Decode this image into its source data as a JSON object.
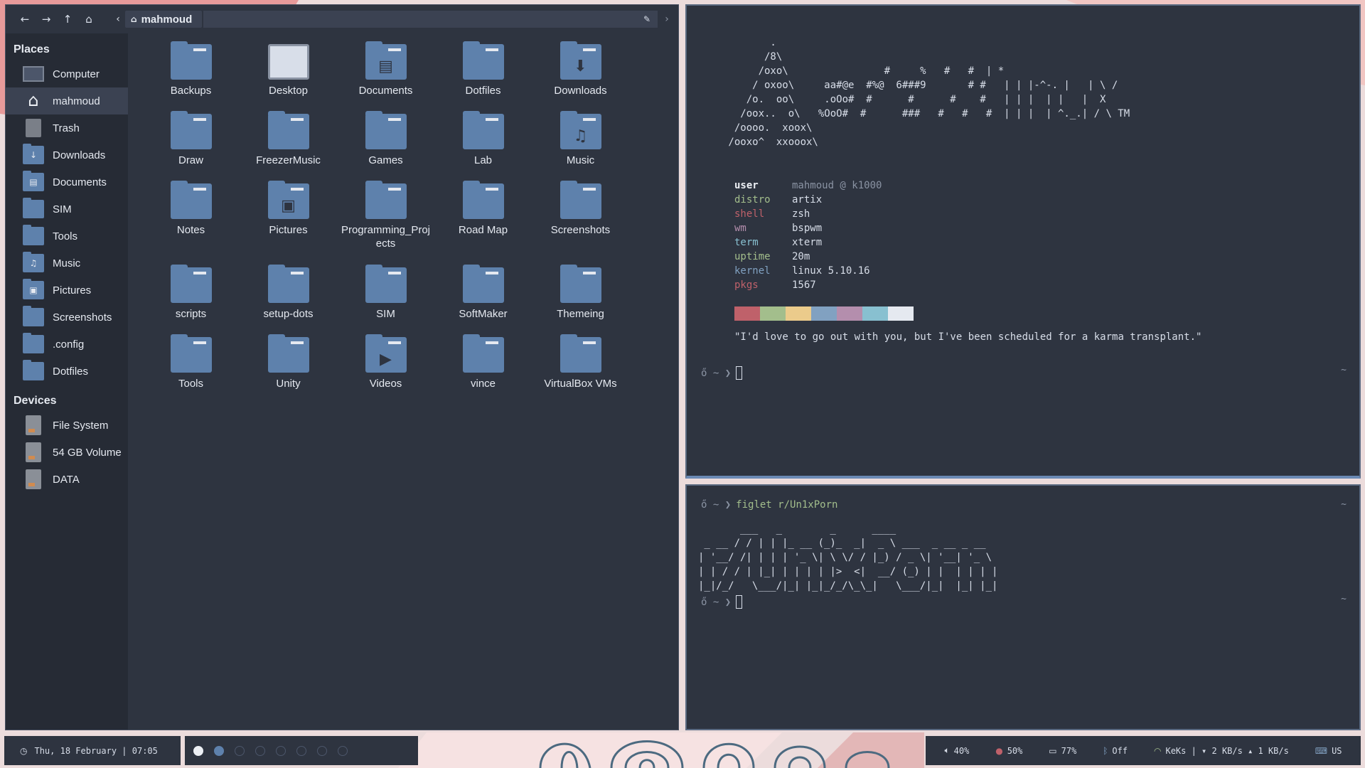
{
  "filemanager": {
    "path": "mahmoud",
    "places_header": "Places",
    "devices_header": "Devices",
    "places": [
      {
        "label": "Computer",
        "icon": "computer-icon"
      },
      {
        "label": "mahmoud",
        "icon": "home-icon"
      },
      {
        "label": "Trash",
        "icon": "trash-icon"
      },
      {
        "label": "Downloads",
        "icon": "downloads-folder-icon"
      },
      {
        "label": "Documents",
        "icon": "documents-folder-icon"
      },
      {
        "label": "SIM",
        "icon": "folder-icon"
      },
      {
        "label": "Tools",
        "icon": "folder-icon"
      },
      {
        "label": "Music",
        "icon": "music-folder-icon"
      },
      {
        "label": "Pictures",
        "icon": "pictures-folder-icon"
      },
      {
        "label": "Screenshots",
        "icon": "folder-icon"
      },
      {
        "label": ".config",
        "icon": "folder-icon"
      },
      {
        "label": "Dotfiles",
        "icon": "folder-icon"
      }
    ],
    "devices": [
      {
        "label": "File System",
        "icon": "drive-icon"
      },
      {
        "label": "54 GB Volume",
        "icon": "drive-icon"
      },
      {
        "label": "DATA",
        "icon": "drive-icon"
      }
    ],
    "items": [
      {
        "label": "Backups",
        "icon": "folder-icon"
      },
      {
        "label": "Desktop",
        "icon": "desktop-icon"
      },
      {
        "label": "Documents",
        "icon": "documents-folder-icon"
      },
      {
        "label": "Dotfiles",
        "icon": "folder-icon"
      },
      {
        "label": "Downloads",
        "icon": "downloads-folder-icon"
      },
      {
        "label": "Draw",
        "icon": "folder-icon"
      },
      {
        "label": "FreezerMusic",
        "icon": "folder-icon"
      },
      {
        "label": "Games",
        "icon": "folder-icon"
      },
      {
        "label": "Lab",
        "icon": "folder-icon"
      },
      {
        "label": "Music",
        "icon": "music-folder-icon"
      },
      {
        "label": "Notes",
        "icon": "folder-icon"
      },
      {
        "label": "Pictures",
        "icon": "pictures-folder-icon"
      },
      {
        "label": "Programming_Proj ects",
        "icon": "folder-icon"
      },
      {
        "label": "Road Map",
        "icon": "folder-icon"
      },
      {
        "label": "Screenshots",
        "icon": "folder-icon"
      },
      {
        "label": "scripts",
        "icon": "folder-icon"
      },
      {
        "label": "setup-dots",
        "icon": "folder-icon"
      },
      {
        "label": "SIM",
        "icon": "folder-icon"
      },
      {
        "label": "SoftMaker",
        "icon": "folder-icon"
      },
      {
        "label": "Themeing",
        "icon": "folder-icon"
      },
      {
        "label": "Tools",
        "icon": "folder-icon"
      },
      {
        "label": "Unity",
        "icon": "folder-icon"
      },
      {
        "label": "Videos",
        "icon": "videos-folder-icon"
      },
      {
        "label": "vince",
        "icon": "folder-icon"
      },
      {
        "label": "VirtualBox VMs",
        "icon": "folder-icon"
      }
    ]
  },
  "terminal_top": {
    "logo_lines": [
      "        .",
      "       /8\\",
      "      /oxo\\                #     %   #   #  | *",
      "     / oxoo\\     aa#@e  #%@  6###9       # #   | | |-^-. |   | \\ /",
      "    /o.  oo\\     .oOo#  #      #      #    #   | | |  | |   |  X",
      "   /oox..  o\\   %OoO#  #      ###   #   #   #  | | |  | ^._.| / \\ TM",
      "  /oooo.  xoox\\",
      " /ooxo^  xxooox\\"
    ],
    "info": [
      {
        "key": "user",
        "value": "mahmoud @ k1000"
      },
      {
        "key": "distro",
        "value": "artix"
      },
      {
        "key": "shell",
        "value": "zsh"
      },
      {
        "key": "wm",
        "value": "bspwm"
      },
      {
        "key": "term",
        "value": "xterm"
      },
      {
        "key": "uptime",
        "value": "20m"
      },
      {
        "key": "kernel",
        "value": "linux 5.10.16"
      },
      {
        "key": "pkgs",
        "value": "1567"
      }
    ],
    "info_key_colors": [
      "#eceff4",
      "#a3be8c",
      "#bf616a",
      "#b48ead",
      "#88c0d0",
      "#a3be8c",
      "#81a1c1",
      "#bf616a"
    ],
    "palette": [
      "#bf616a",
      "#a3be8c",
      "#ebcb8b",
      "#81a1c1",
      "#b48ead",
      "#88c0d0",
      "#e5e9f0"
    ],
    "quote": "\"I'd love to go out with you, but I've been scheduled for a karma transplant.\"",
    "prompt_symbol": "ő ~ ❯",
    "right_tilde": "~"
  },
  "terminal_bottom": {
    "prompt_symbol": "ő ~ ❯",
    "command": "figlet r/Un1xPorn",
    "figlet_lines": [
      "       ___   _        _      ____",
      " _ __ / / | | |_ __ (_)_  _|  _ \\ ___  _ __ _ __",
      "| '__/ /| | | | '_ \\| \\ \\/ / |_) / _ \\| '__| '_ \\",
      "| | / / | |_| | | | | |>  <|  __/ (_) | |  | | | |",
      "|_|/_/   \\___/|_| |_|_/_/\\_\\_|   \\___/|_|  |_| |_|"
    ],
    "right_tilde": "~"
  },
  "bars": {
    "clock": "Thu, 18 February | 07:05",
    "workspaces": [
      "on",
      "sel",
      "off",
      "off",
      "off",
      "off",
      "off",
      "off"
    ],
    "volume": "40%",
    "brightness": "50%",
    "battery": "77%",
    "bluetooth": "Off",
    "wifi": "KeKs | ▾ 2 KB/s  ▴ 1 KB/s",
    "keyboard": "US"
  },
  "colors": {
    "bg": "#2e3440",
    "accent": "#5e81ac",
    "text": "#d8dee9"
  }
}
